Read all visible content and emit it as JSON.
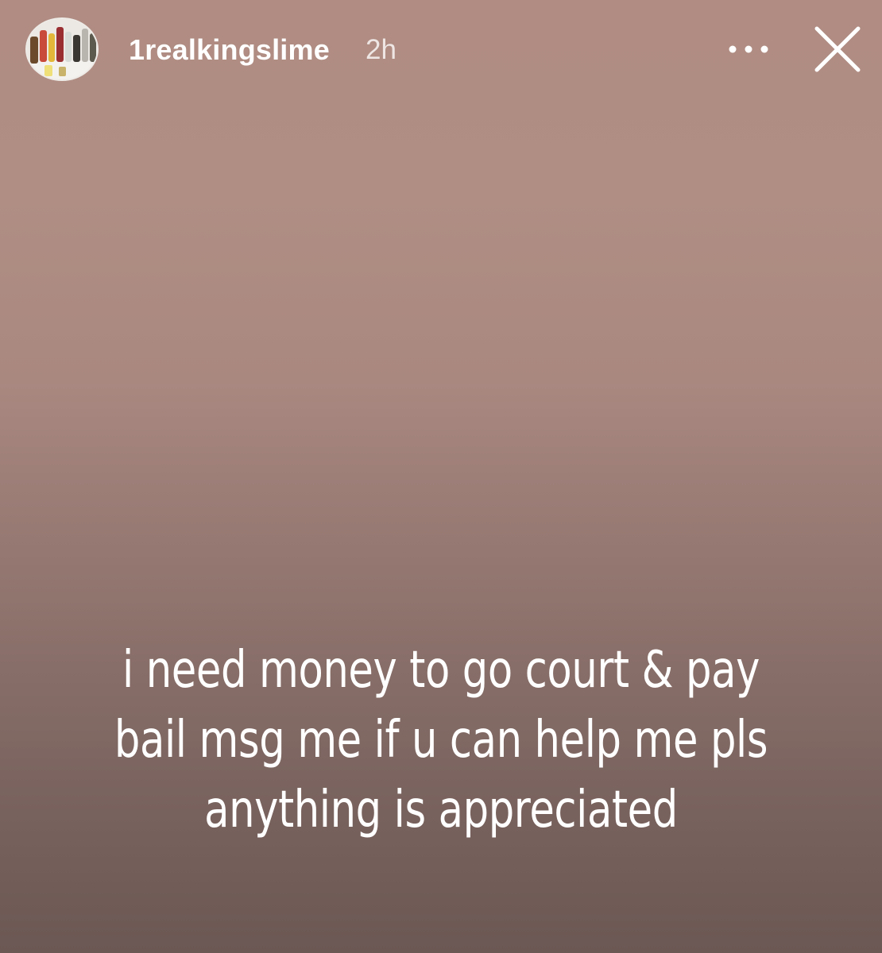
{
  "story": {
    "author": {
      "username": "1realkingslime",
      "posted_ago": "2h"
    },
    "actions": {
      "more_icon": "more-horizontal-icon",
      "close_icon": "close-icon"
    },
    "caption_text": "i need money to go court & pay bail msg me if u can help me pls anything is appreciated"
  },
  "colors": {
    "background_top": "#b08c82",
    "background_bottom": "#6b5753",
    "text": "#ffffff"
  }
}
